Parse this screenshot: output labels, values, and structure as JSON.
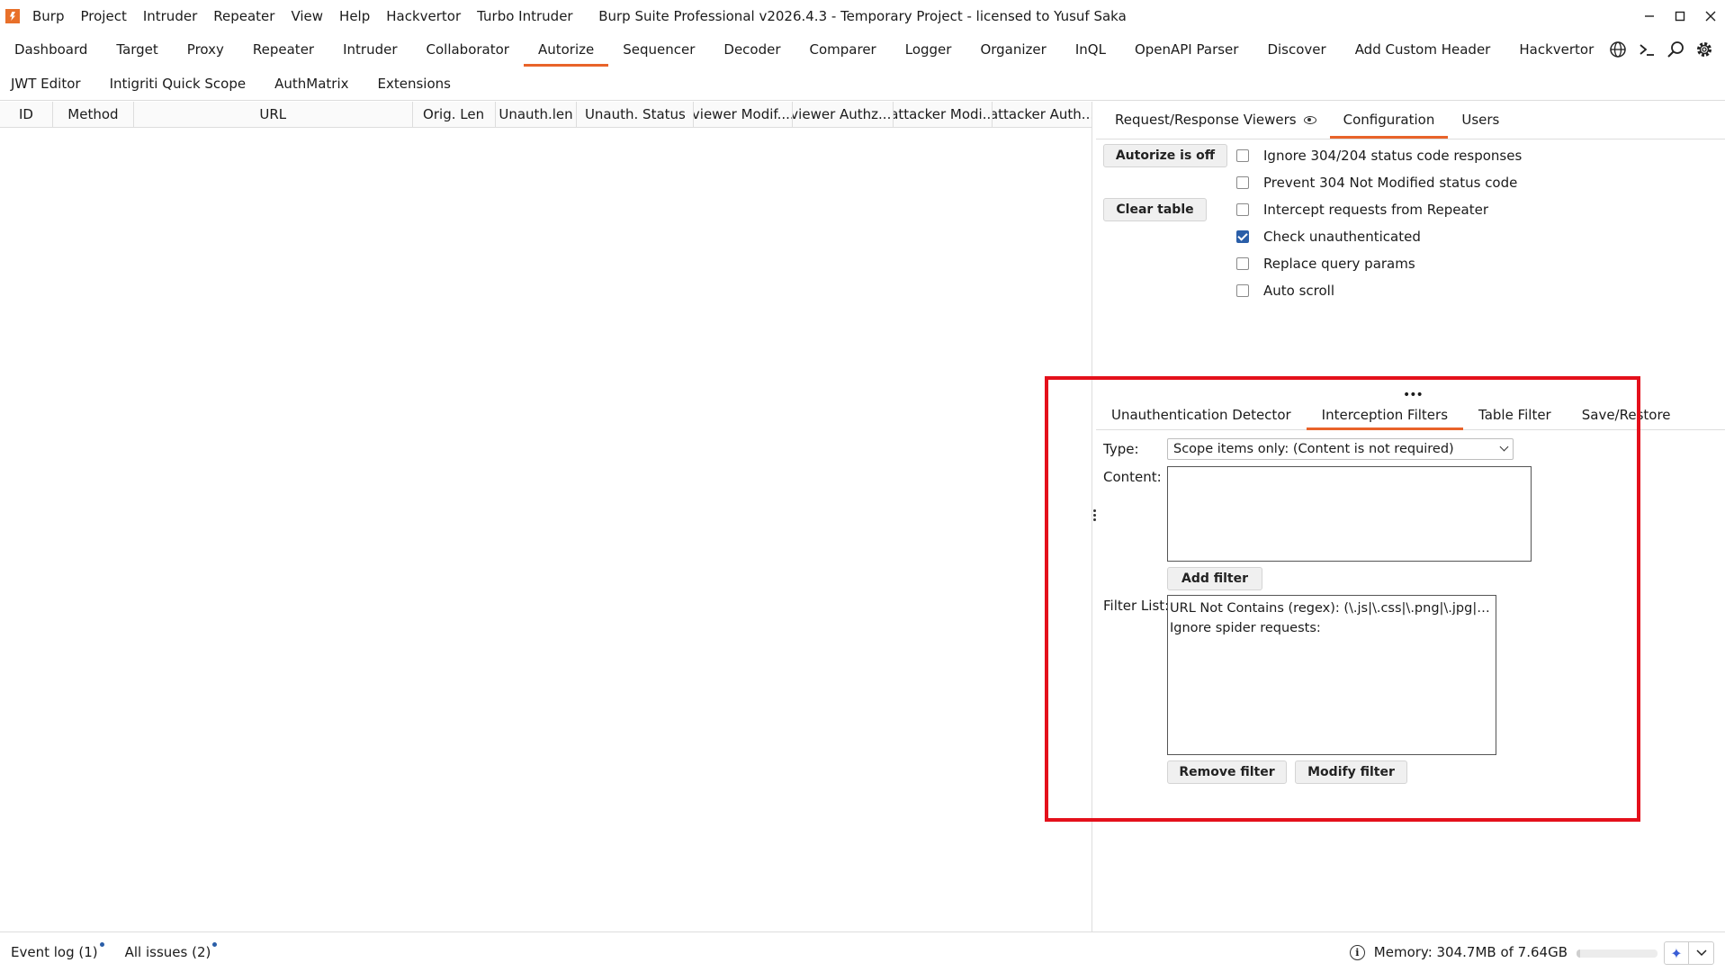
{
  "menu": {
    "items": [
      "Burp",
      "Project",
      "Intruder",
      "Repeater",
      "View",
      "Help",
      "Hackvertor",
      "Turbo Intruder"
    ]
  },
  "window": {
    "title": "Burp Suite Professional v2026.4.3 - Temporary Project - licensed to Yusuf Saka"
  },
  "tool_tabs": {
    "row1": [
      "Dashboard",
      "Target",
      "Proxy",
      "Repeater",
      "Intruder",
      "Collaborator",
      "Autorize",
      "Sequencer",
      "Decoder",
      "Comparer",
      "Logger",
      "Organizer",
      "InQL",
      "OpenAPI Parser",
      "Discover",
      "Add Custom Header",
      "Hackvertor"
    ],
    "row2": [
      "JWT Editor",
      "Intigriti Quick Scope",
      "AuthMatrix",
      "Extensions"
    ],
    "active": "Autorize"
  },
  "table": {
    "columns": [
      "ID",
      "Method",
      "URL",
      "Orig. Len",
      "Unauth.len",
      "Unauth. Status",
      "viewer Modif....",
      "viewer Authz....",
      "attacker Modi...",
      "attacker Auth..."
    ]
  },
  "right_tabs": {
    "items": [
      "Request/Response Viewers",
      "Configuration",
      "Users"
    ],
    "active": "Configuration"
  },
  "config": {
    "autorize_button": "Autorize is off",
    "clear_button": "Clear table",
    "checkboxes": [
      {
        "label": "Ignore 304/204 status code responses",
        "checked": false
      },
      {
        "label": "Prevent 304 Not Modified status code",
        "checked": false
      },
      {
        "label": "Intercept requests from Repeater",
        "checked": false
      },
      {
        "label": "Check unauthenticated",
        "checked": true
      },
      {
        "label": "Replace query params",
        "checked": false
      },
      {
        "label": "Auto scroll",
        "checked": false
      }
    ]
  },
  "sub_tabs": {
    "items": [
      "Unauthentication Detector",
      "Interception Filters",
      "Table Filter",
      "Save/Restore"
    ],
    "active": "Interception Filters"
  },
  "filters": {
    "type_label": "Type:",
    "type_value": "Scope items only: (Content is not required)",
    "content_label": "Content:",
    "content_value": "",
    "add_button": "Add filter",
    "list_label": "Filter List:",
    "list": [
      "URL Not Contains (regex): (\\.js|\\.css|\\.png|\\.jpg|\\.s...",
      "Ignore spider requests:"
    ],
    "remove_button": "Remove filter",
    "modify_button": "Modify filter"
  },
  "status": {
    "event_log": "Event log (1)",
    "all_issues": "All issues (2)",
    "memory": "Memory: 304.7MB of 7.64GB",
    "memory_fraction": 0.04
  },
  "colors": {
    "accent": "#e8632a",
    "highlight": "#e4101b",
    "checkbox": "#2a5ea8"
  }
}
